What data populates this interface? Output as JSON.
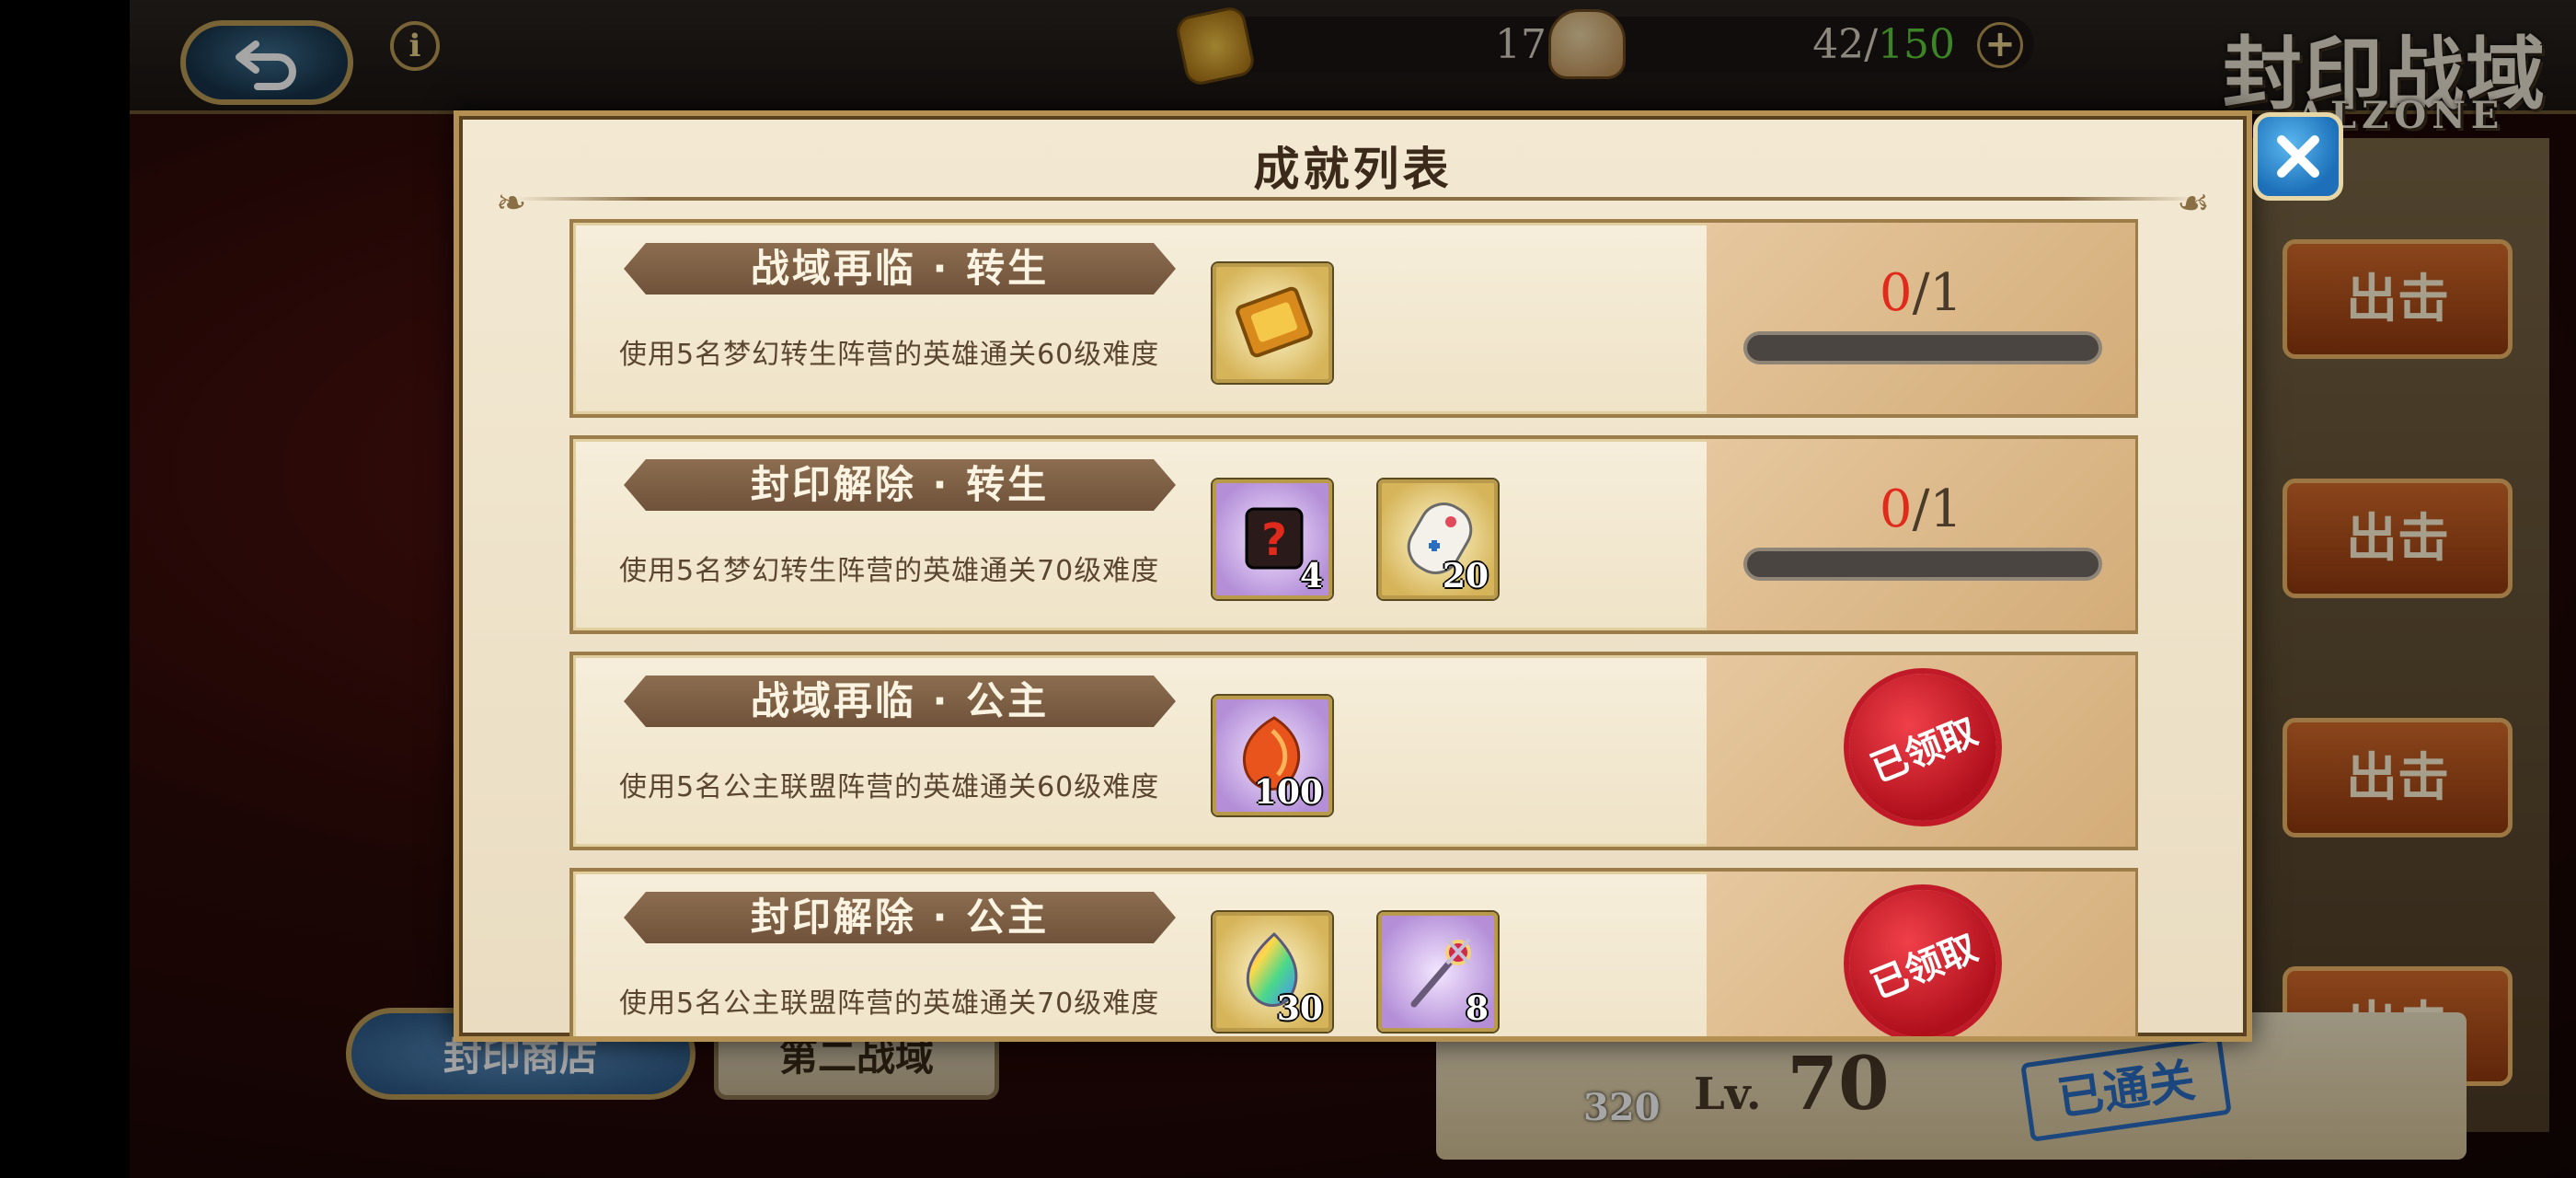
{
  "topbar": {
    "gem_count": "1710",
    "stamina_current": "42",
    "stamina_separator": "/",
    "stamina_max": "150",
    "info_glyph": "i",
    "plus_glyph": "+"
  },
  "logo": {
    "title": "封印战域",
    "subtitle": "ALZONE"
  },
  "background": {
    "right_buttons": [
      "出击",
      "出击",
      "出击",
      "出击"
    ],
    "shop_label": "封印商店",
    "area_label": "第二战域",
    "level_prefix": "Lv.",
    "level_value": "70",
    "cleared_badge": "已通关",
    "item_count": "320"
  },
  "modal": {
    "title": "成就列表",
    "close_icon": "close-x-icon",
    "achievements": [
      {
        "title": "战域再临 · 转生",
        "description": "使用5名梦幻转生阵营的英雄通关60级难度",
        "rewards": [
          {
            "icon": "golden-ticket-icon",
            "qty": ""
          }
        ],
        "status": "progress",
        "progress_current": "0",
        "progress_total": "/1",
        "progress_fraction": 0
      },
      {
        "title": "封印解除 · 转生",
        "description": "使用5名梦幻转生阵营的英雄通关70级难度",
        "rewards": [
          {
            "icon": "mystery-scroll-icon",
            "qty": "4"
          },
          {
            "icon": "gamepad-icon",
            "qty": "20"
          }
        ],
        "status": "progress",
        "progress_current": "0",
        "progress_total": "/1",
        "progress_fraction": 0
      },
      {
        "title": "战域再临 · 公主",
        "description": "使用5名公主联盟阵营的英雄通关60级难度",
        "rewards": [
          {
            "icon": "fire-crystal-icon",
            "qty": "100"
          }
        ],
        "status": "claimed",
        "claimed_label": "已领取"
      },
      {
        "title": "封印解除 · 公主",
        "description": "使用5名公主联盟阵营的英雄通关70级难度",
        "rewards": [
          {
            "icon": "rainbow-crystal-icon",
            "qty": "30"
          },
          {
            "icon": "jeweled-staff-icon",
            "qty": "8"
          }
        ],
        "status": "claimed",
        "claimed_label": "已领取"
      }
    ]
  },
  "colors": {
    "progress_current": "#e02a1c",
    "stamina_max": "#5ccb3a",
    "seal_red": "#c01a28",
    "modal_bg": "#f3e9d3"
  }
}
